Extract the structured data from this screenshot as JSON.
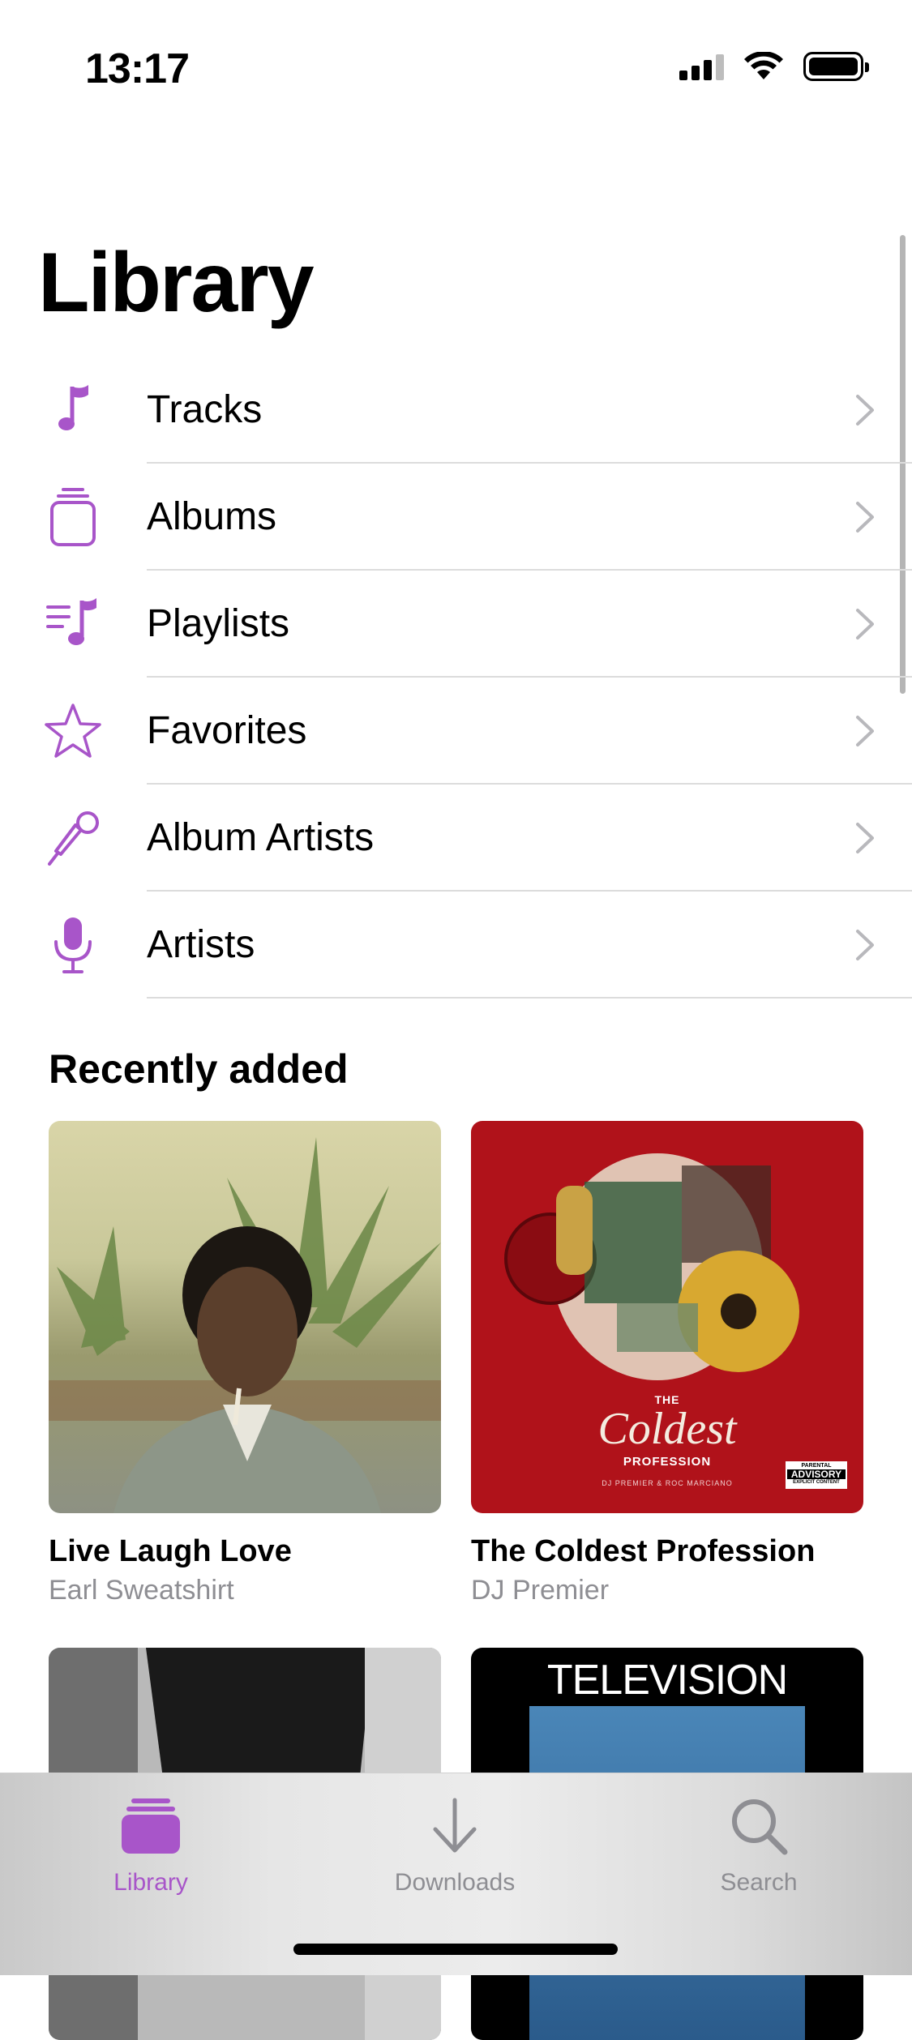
{
  "status": {
    "time": "13:17"
  },
  "page": {
    "title": "Library"
  },
  "colors": {
    "accent": "#a855c9",
    "chevron": "#b8b8bc",
    "secondary_text": "#8e8e93"
  },
  "menu": [
    {
      "label": "Tracks",
      "icon": "music-note-icon"
    },
    {
      "label": "Albums",
      "icon": "album-stack-icon"
    },
    {
      "label": "Playlists",
      "icon": "playlist-icon"
    },
    {
      "label": "Favorites",
      "icon": "star-icon"
    },
    {
      "label": "Album Artists",
      "icon": "microphone-tilted-icon"
    },
    {
      "label": "Artists",
      "icon": "microphone-icon"
    }
  ],
  "recently_added": {
    "title": "Recently added",
    "albums": [
      {
        "title": "Live Laugh Love",
        "artist": "Earl Sweatshirt"
      },
      {
        "title": "The Coldest Profession",
        "artist": "DJ Premier",
        "cover_text": {
          "the": "THE",
          "main": "Coldest",
          "sub": "PROFESSION",
          "credits": "DJ PREMIER & ROC MARCIANO",
          "advisory_top": "PARENTAL",
          "advisory_mid": "ADVISORY",
          "advisory_bottom": "EXPLICIT CONTENT"
        }
      },
      {
        "title": "",
        "artist": ""
      },
      {
        "title": "",
        "artist": "",
        "cover_text": {
          "main": "TELEVISION"
        }
      }
    ]
  },
  "tabs": [
    {
      "label": "Library",
      "icon": "library-icon",
      "active": true
    },
    {
      "label": "Downloads",
      "icon": "download-icon",
      "active": false
    },
    {
      "label": "Search",
      "icon": "search-icon",
      "active": false
    }
  ]
}
